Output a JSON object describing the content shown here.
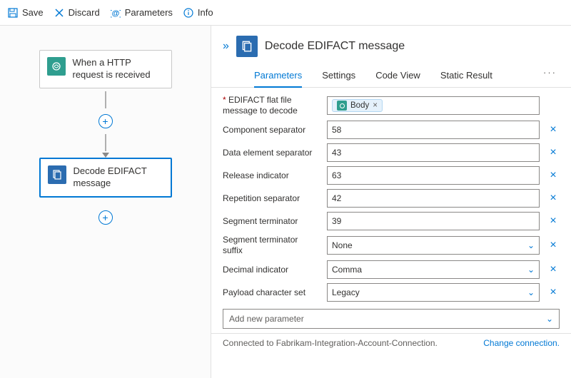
{
  "toolbar": {
    "save": "Save",
    "discard": "Discard",
    "parameters": "Parameters",
    "info": "Info"
  },
  "canvas": {
    "node1": "When a HTTP request is received",
    "node2": "Decode EDIFACT message"
  },
  "panel": {
    "title": "Decode EDIFACT message",
    "tabs": {
      "parameters": "Parameters",
      "settings": "Settings",
      "codeview": "Code View",
      "staticresult": "Static Result"
    },
    "fields": {
      "flatfile_label": "EDIFACT flat file message to decode",
      "flatfile_token": "Body",
      "comp_sep_label": "Component separator",
      "comp_sep_value": "58",
      "data_sep_label": "Data element separator",
      "data_sep_value": "43",
      "release_label": "Release indicator",
      "release_value": "63",
      "rep_sep_label": "Repetition separator",
      "rep_sep_value": "42",
      "seg_term_label": "Segment terminator",
      "seg_term_value": "39",
      "seg_suffix_label": "Segment terminator suffix",
      "seg_suffix_value": "None",
      "decimal_label": "Decimal indicator",
      "decimal_value": "Comma",
      "charset_label": "Payload character set",
      "charset_value": "Legacy",
      "addnew": "Add new parameter"
    },
    "footer": {
      "connected": "Connected to Fabrikam-Integration-Account-Connection.",
      "change": "Change connection."
    }
  }
}
